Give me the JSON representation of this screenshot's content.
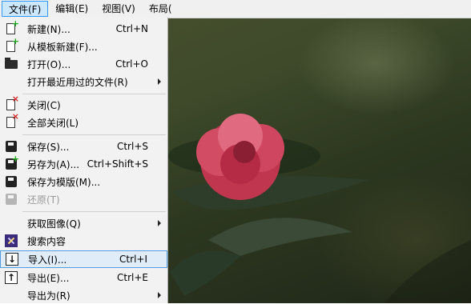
{
  "menubar": {
    "items": [
      {
        "label": "文件(F)",
        "active": true
      },
      {
        "label": "编辑(E)"
      },
      {
        "label": "视图(V)"
      },
      {
        "label": "布局("
      }
    ]
  },
  "file_menu": {
    "items": [
      {
        "label": "新建(N)...",
        "shortcut": "Ctrl+N",
        "icon": "new-document-icon"
      },
      {
        "label": "从模板新建(F)...",
        "shortcut": "",
        "icon": "new-from-template-icon"
      },
      {
        "label": "打开(O)...",
        "shortcut": "Ctrl+O",
        "icon": "folder-open-icon"
      },
      {
        "label": "打开最近用过的文件(R)",
        "shortcut": "",
        "submenu": true
      },
      {
        "label": "关闭(C)",
        "shortcut": "",
        "icon": "close-document-icon"
      },
      {
        "label": "全部关闭(L)",
        "shortcut": "",
        "icon": "close-all-icon"
      },
      {
        "label": "保存(S)...",
        "shortcut": "Ctrl+S",
        "icon": "save-icon"
      },
      {
        "label": "另存为(A)...",
        "shortcut": "Ctrl+Shift+S",
        "icon": "save-as-icon"
      },
      {
        "label": "保存为模版(M)...",
        "shortcut": "",
        "icon": "save-as-template-icon"
      },
      {
        "label": "还原(T)",
        "shortcut": "",
        "icon": "revert-icon",
        "disabled": true
      },
      {
        "label": "获取图像(Q)",
        "shortcut": "",
        "submenu": true
      },
      {
        "label": "搜索内容",
        "shortcut": "",
        "icon": "search-content-icon"
      },
      {
        "label": "导入(I)...",
        "shortcut": "Ctrl+I",
        "icon": "import-icon",
        "hover": true
      },
      {
        "label": "导出(E)...",
        "shortcut": "Ctrl+E",
        "icon": "export-icon"
      },
      {
        "label": "导出为(R)",
        "shortcut": "",
        "submenu": true
      }
    ]
  },
  "colors": {
    "menu_bg": "#f2f2f2",
    "hover_bg": "#e0ecf8",
    "hover_border": "#4e9ee0",
    "active_menu_bg": "#cce8ff",
    "plus_green": "#1aa91a",
    "close_red": "#d21f1f"
  }
}
